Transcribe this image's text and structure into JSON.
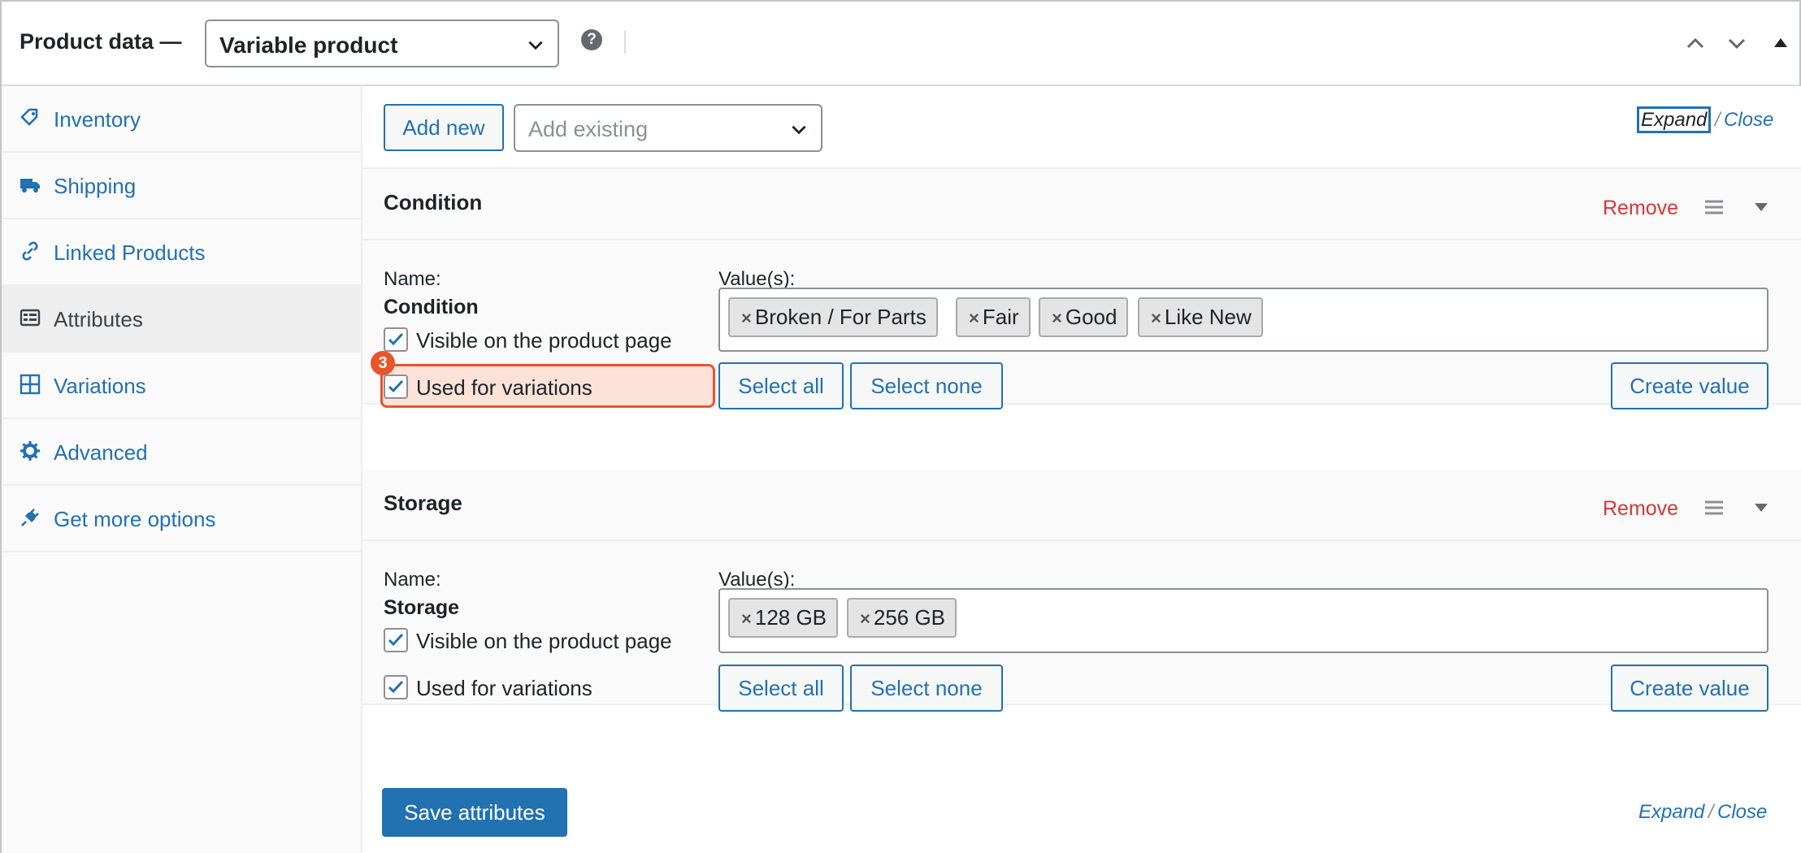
{
  "header": {
    "title": "Product data —",
    "product_type": "Variable product",
    "help_icon": "question-circle-icon"
  },
  "sidebar": {
    "items": [
      {
        "label": "Inventory",
        "icon": "tag-icon"
      },
      {
        "label": "Shipping",
        "icon": "truck-icon"
      },
      {
        "label": "Linked Products",
        "icon": "link-icon"
      },
      {
        "label": "Attributes",
        "icon": "list-card-icon",
        "active": true
      },
      {
        "label": "Variations",
        "icon": "grid-icon"
      },
      {
        "label": "Advanced",
        "icon": "gear-icon"
      },
      {
        "label": "Get more options",
        "icon": "plug-icon"
      }
    ]
  },
  "toolbar": {
    "add_new": "Add new",
    "add_existing_placeholder": "Add existing",
    "expand": "Expand",
    "slash": "/",
    "close": "Close"
  },
  "attributes": [
    {
      "title": "Condition",
      "remove": "Remove",
      "name_label": "Name:",
      "name_value": "Condition",
      "values_label": "Value(s):",
      "values": [
        "Broken / For Parts",
        "Fair",
        "Good",
        "Like New"
      ],
      "visible_label": "Visible on the product page",
      "visible_checked": true,
      "variations_label": "Used for variations",
      "variations_checked": true,
      "select_all": "Select all",
      "select_none": "Select none",
      "create_value": "Create value"
    },
    {
      "title": "Storage",
      "remove": "Remove",
      "name_label": "Name:",
      "name_value": "Storage",
      "values_label": "Value(s):",
      "values": [
        "128 GB",
        "256 GB"
      ],
      "visible_label": "Visible on the product page",
      "visible_checked": true,
      "variations_label": "Used for variations",
      "variations_checked": true,
      "select_all": "Select all",
      "select_none": "Select none",
      "create_value": "Create value"
    }
  ],
  "annotation": {
    "step": "3"
  },
  "footer": {
    "save": "Save attributes",
    "expand": "Expand",
    "slash": "/",
    "close": "Close"
  },
  "colors": {
    "link": "#2271b1",
    "remove": "#d63638",
    "highlight_border": "#e8552d",
    "highlight_fill": "#fde2d9"
  }
}
